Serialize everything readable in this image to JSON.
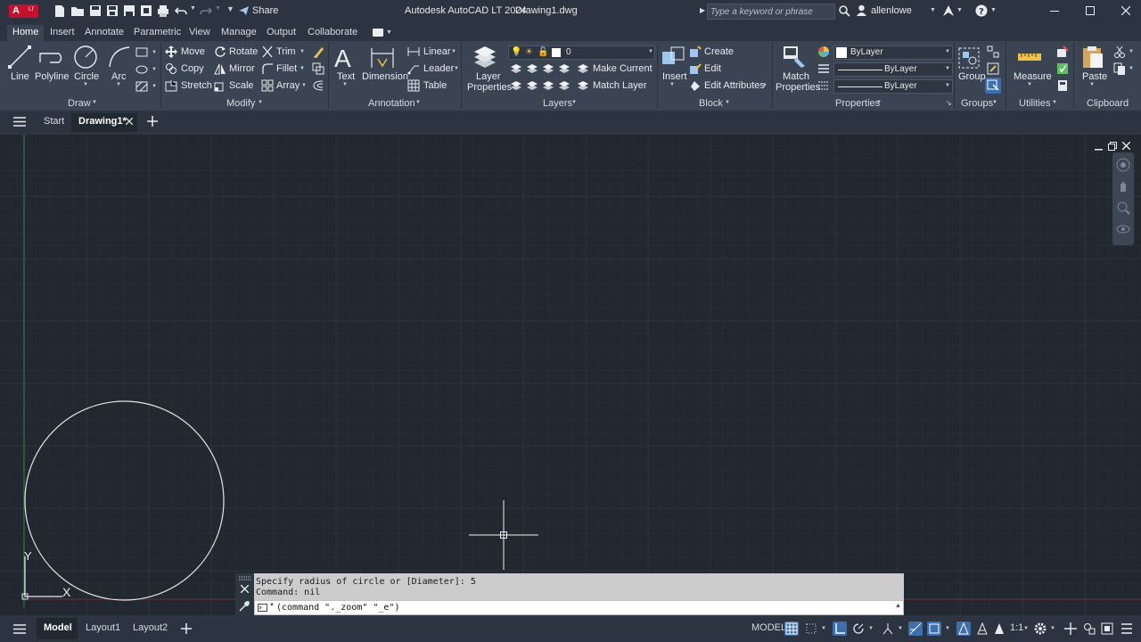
{
  "app": {
    "badge": "A",
    "badge_sub": "LT",
    "title": "Autodesk AutoCAD LT 2024",
    "document": "Drawing1.dwg",
    "share_label": "Share",
    "search_placeholder": "Type a keyword or phrase",
    "user": "allenlowe",
    "colors": {
      "accent": "#c8102e",
      "canvas": "#212830",
      "ribbon": "#3a4452",
      "highlight": "#3b6fb0"
    }
  },
  "tabs": [
    "Home",
    "Insert",
    "Annotate",
    "Parametric",
    "View",
    "Manage",
    "Output",
    "Collaborate"
  ],
  "ribbon": {
    "draw": {
      "title": "Draw",
      "line": "Line",
      "polyline": "Polyline",
      "circle": "Circle",
      "arc": "Arc"
    },
    "modify": {
      "title": "Modify",
      "move": "Move",
      "rotate": "Rotate",
      "trim": "Trim",
      "copy": "Copy",
      "mirror": "Mirror",
      "fillet": "Fillet",
      "stretch": "Stretch",
      "scale": "Scale",
      "array": "Array"
    },
    "annotation": {
      "title": "Annotation",
      "text": "Text",
      "dimension": "Dimension",
      "linear": "Linear",
      "leader": "Leader",
      "table": "Table"
    },
    "layers": {
      "title": "Layers",
      "layer_properties_1": "Layer",
      "layer_properties_2": "Properties",
      "current_layer": "0",
      "make_current": "Make Current",
      "match_layer": "Match Layer"
    },
    "block": {
      "title": "Block",
      "insert": "Insert",
      "create": "Create",
      "edit": "Edit",
      "edit_attributes": "Edit Attributes"
    },
    "properties": {
      "title": "Properties",
      "match_1": "Match",
      "match_2": "Properties",
      "color": "ByLayer",
      "linetype": "ByLayer",
      "lineweight": "ByLayer"
    },
    "groups": {
      "title": "Groups",
      "group": "Group"
    },
    "utilities": {
      "title": "Utilities",
      "measure": "Measure"
    },
    "clipboard": {
      "title": "Clipboard",
      "paste": "Paste"
    }
  },
  "filetabs": {
    "start": "Start",
    "drawing": "Drawing1*"
  },
  "canvas": {
    "ucs_y": "Y",
    "ucs_x": "X"
  },
  "command": {
    "history": [
      "Specify radius of circle or [Diameter]: 5",
      "Command: nil"
    ],
    "input": "(command \"._zoom\" \"_e\")"
  },
  "statusbar": {
    "model": "Model",
    "layout1": "Layout1",
    "layout2": "Layout2",
    "space": "MODEL",
    "scale": "1:1"
  }
}
